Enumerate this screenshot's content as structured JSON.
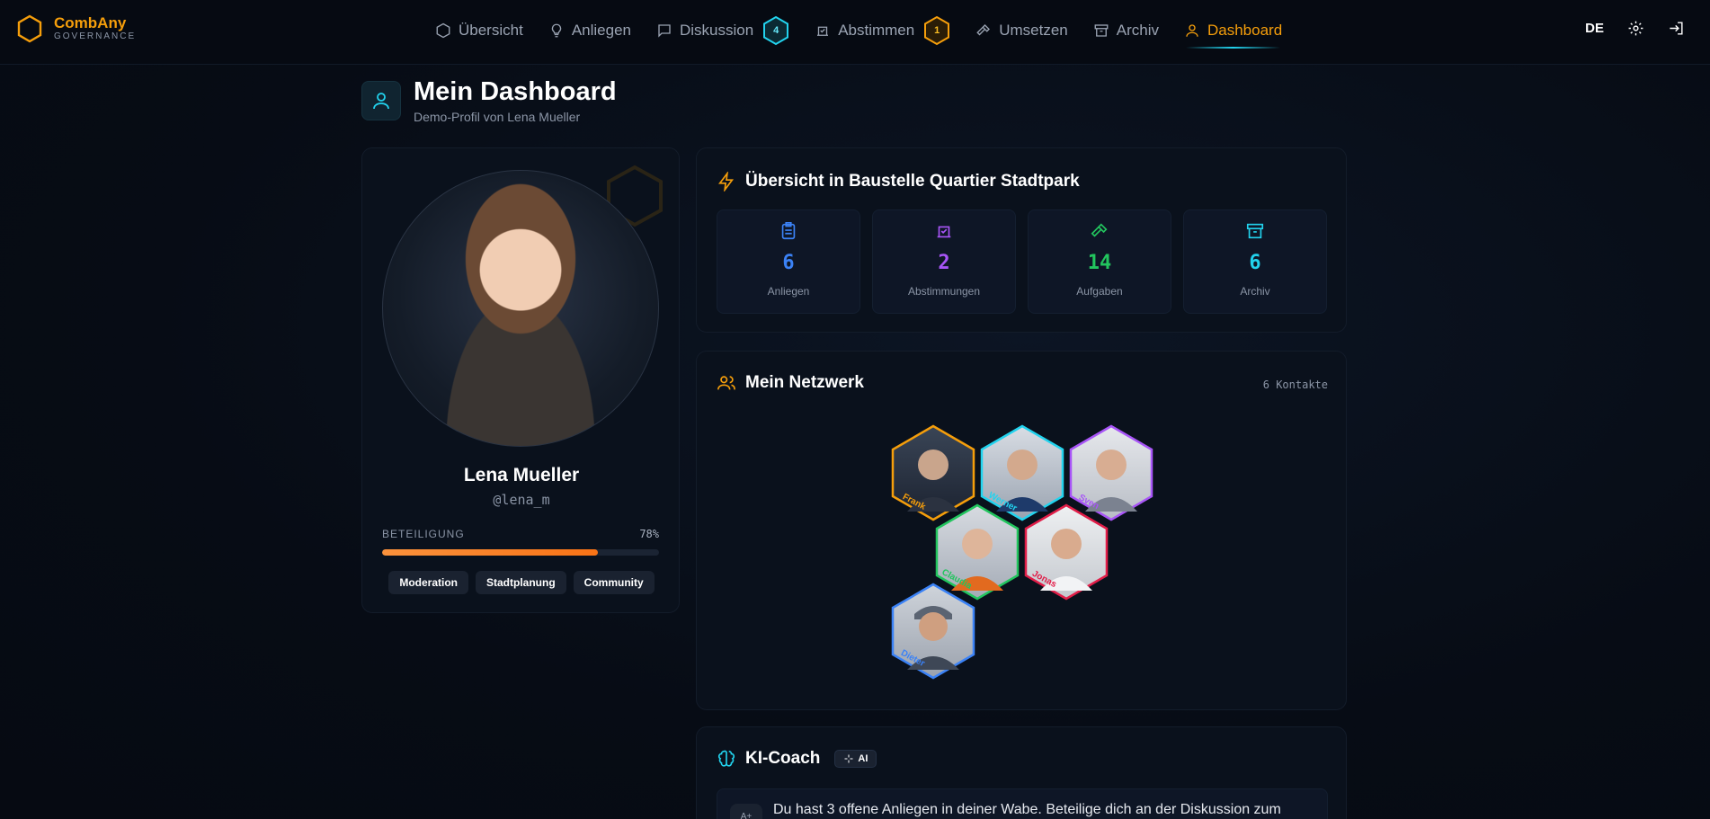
{
  "brand": {
    "name": "CombAny",
    "sub": "GOVERNANCE"
  },
  "nav": {
    "items": [
      {
        "label": "Übersicht",
        "icon": "hexagon-icon"
      },
      {
        "label": "Anliegen",
        "icon": "lightbulb-icon"
      },
      {
        "label": "Diskussion",
        "icon": "chat-icon",
        "badge": "4"
      },
      {
        "label": "Abstimmen",
        "icon": "vote-icon",
        "badge": "1"
      },
      {
        "label": "Umsetzen",
        "icon": "hammer-icon"
      },
      {
        "label": "Archiv",
        "icon": "archive-icon"
      },
      {
        "label": "Dashboard",
        "icon": "user-icon",
        "active": true
      }
    ],
    "lang": "DE"
  },
  "page": {
    "title": "Mein Dashboard",
    "subtitle": "Demo-Profil von Lena Mueller"
  },
  "profile": {
    "name": "Lena Mueller",
    "handle": "@lena_m",
    "participation_label": "BETEILIGUNG",
    "participation_value": "78%",
    "participation_fraction": 0.78,
    "tags": [
      "Moderation",
      "Stadtplanung",
      "Community"
    ]
  },
  "overview": {
    "title": "Übersicht in Baustelle Quartier Stadtpark",
    "stats": [
      {
        "value": "6",
        "label": "Anliegen",
        "color": "#3b82f6",
        "icon": "clipboard-icon"
      },
      {
        "value": "2",
        "label": "Abstimmungen",
        "color": "#a855f7",
        "icon": "vote-icon"
      },
      {
        "value": "14",
        "label": "Aufgaben",
        "color": "#22c55e",
        "icon": "hammer-icon"
      },
      {
        "value": "6",
        "label": "Archiv",
        "color": "#22d3ee",
        "icon": "archive-icon"
      }
    ]
  },
  "network": {
    "title": "Mein Netzwerk",
    "count": "6 Kontakte",
    "contacts": [
      {
        "name": "Frank",
        "color": "#f59e0b"
      },
      {
        "name": "Werner",
        "color": "#22d3ee"
      },
      {
        "name": "Sven",
        "color": "#a855f7"
      },
      {
        "name": "Claudia",
        "color": "#22c55e"
      },
      {
        "name": "Jonas",
        "color": "#e11d48"
      },
      {
        "name": "Dieter",
        "color": "#3b82f6"
      }
    ]
  },
  "coach": {
    "title": "KI-Coach",
    "badge": "AI",
    "avatar": "A+",
    "message": "Du hast 3 offene Anliegen in deiner Wabe. Beteilige dich an der Diskussion zum"
  },
  "colors": {
    "accent": "#f59e0b",
    "cyan": "#22d3ee",
    "bg": "#070c15"
  }
}
